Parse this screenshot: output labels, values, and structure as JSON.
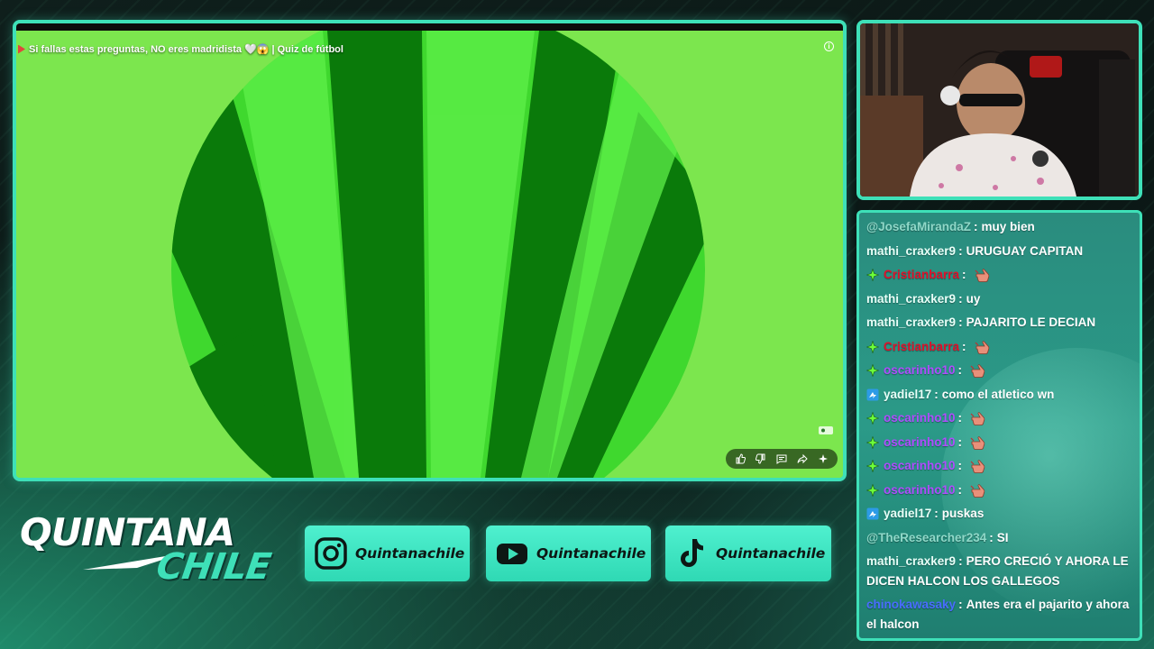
{
  "video": {
    "title": "Si fallas estas preguntas, NO eres madridista 🤍😱 | Quiz de fútbol",
    "background_color": "#7ce64e",
    "stripe_dark": "#0a7a0a",
    "stripe_light": "#4ee63a"
  },
  "video_actions": [
    "like-icon",
    "dislike-icon",
    "comment-icon",
    "share-icon",
    "sparkle-icon"
  ],
  "chat": {
    "messages": [
      {
        "badge": "none",
        "user": "@JosefaMirandaZ",
        "user_color": "#8fd8c8",
        "text": "muy bien",
        "emote": false
      },
      {
        "badge": "none",
        "user": "mathi_craxker9",
        "user_color": "#e8fff8",
        "text": "URUGUAY CAPITAN",
        "emote": false
      },
      {
        "badge": "star",
        "user": "Cristianbarra",
        "user_color": "#e0102a",
        "text": "",
        "emote": true
      },
      {
        "badge": "none",
        "user": "mathi_craxker9",
        "user_color": "#e8fff8",
        "text": "uy",
        "emote": false
      },
      {
        "badge": "none",
        "user": "mathi_craxker9",
        "user_color": "#e8fff8",
        "text": "PAJARITO LE DECIAN",
        "emote": false
      },
      {
        "badge": "star",
        "user": "Cristianbarra",
        "user_color": "#e0102a",
        "text": "",
        "emote": true
      },
      {
        "badge": "star",
        "user": "oscarinho10",
        "user_color": "#b04cff",
        "text": "",
        "emote": true
      },
      {
        "badge": "prime",
        "user": "yadiel17",
        "user_color": "#e8fff8",
        "text": "como el atletico wn",
        "emote": false
      },
      {
        "badge": "star",
        "user": "oscarinho10",
        "user_color": "#b04cff",
        "text": "",
        "emote": true
      },
      {
        "badge": "star",
        "user": "oscarinho10",
        "user_color": "#b04cff",
        "text": "",
        "emote": true
      },
      {
        "badge": "star",
        "user": "oscarinho10",
        "user_color": "#b04cff",
        "text": "",
        "emote": true
      },
      {
        "badge": "star",
        "user": "oscarinho10",
        "user_color": "#b04cff",
        "text": "",
        "emote": true
      },
      {
        "badge": "prime",
        "user": "yadiel17",
        "user_color": "#e8fff8",
        "text": "puskas",
        "emote": false
      },
      {
        "badge": "none",
        "user": "@TheResearcher234",
        "user_color": "#8fd8c8",
        "text": "SI",
        "emote": false
      },
      {
        "badge": "none",
        "user": "mathi_craxker9",
        "user_color": "#e8fff8",
        "text": "PERO CRECIÓ Y AHORA LE DICEN HALCON LOS GALLEGOS",
        "emote": false
      },
      {
        "badge": "none",
        "user": "chinokawasaky",
        "user_color": "#4a6cff",
        "text": "Antes era el pajarito y ahora el halcon",
        "emote": false
      }
    ]
  },
  "logo": {
    "line1": "QUINTANA",
    "line2": "CHILE"
  },
  "socials": [
    {
      "platform": "instagram-icon",
      "label": "Quintanachile"
    },
    {
      "platform": "youtube-icon",
      "label": "Quintanachile"
    },
    {
      "platform": "tiktok-icon",
      "label": "Quintanachile"
    }
  ],
  "colors": {
    "accent": "#3ee0b8",
    "chat_bg": "#2a8c7e",
    "social_bg": "#3ee0b8"
  }
}
